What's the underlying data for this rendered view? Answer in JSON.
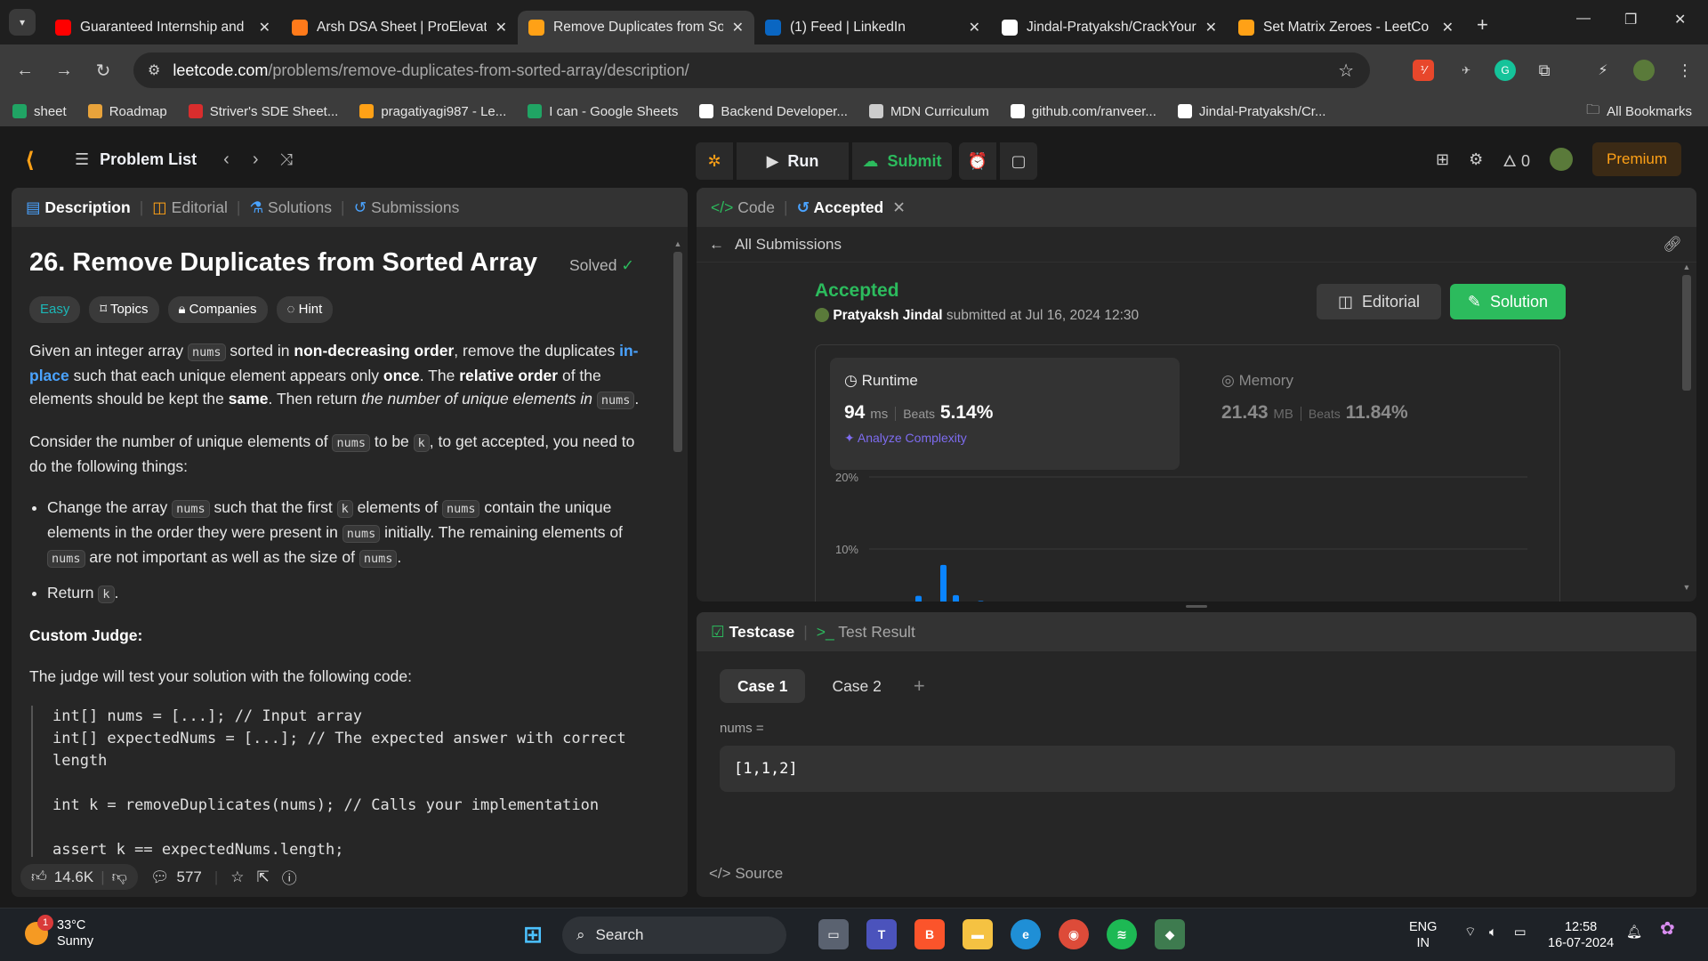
{
  "browser": {
    "tabs": [
      {
        "title": "Guaranteed Internship and",
        "favicon": "youtube-icon",
        "color": "#ff0000"
      },
      {
        "title": "Arsh DSA Sheet | ProElevat",
        "favicon": "proelevate-icon",
        "color": "#ff7a1a"
      },
      {
        "title": "Remove Duplicates from So",
        "favicon": "leetcode-icon",
        "color": "#ffa116",
        "active": true
      },
      {
        "title": "(1) Feed | LinkedIn",
        "favicon": "linkedin-icon",
        "color": "#0a66c2"
      },
      {
        "title": "Jindal-Pratyaksh/CrackYour",
        "favicon": "github-icon",
        "color": "#ffffff"
      },
      {
        "title": "Set Matrix Zeroes - LeetCo",
        "favicon": "leetcode-icon",
        "color": "#ffa116"
      }
    ],
    "url_host": "leetcode.com",
    "url_path": "/problems/remove-duplicates-from-sorted-array/description/",
    "bookmarks": [
      {
        "label": "sheet",
        "color": "#20a464"
      },
      {
        "label": "Roadmap",
        "color": "#e8a33b"
      },
      {
        "label": "Striver's SDE Sheet...",
        "color": "#d92d2d"
      },
      {
        "label": "pragatiyagi987 - Le...",
        "color": "#ffa116"
      },
      {
        "label": "I can - Google Sheets",
        "color": "#20a464"
      },
      {
        "label": "Backend Developer...",
        "color": "#ffffff"
      },
      {
        "label": "MDN Curriculum",
        "color": "#cccccc"
      },
      {
        "label": "github.com/ranveer...",
        "color": "#ffffff"
      },
      {
        "label": "Jindal-Pratyaksh/Cr...",
        "color": "#ffffff"
      }
    ],
    "all_bookmarks": "All Bookmarks"
  },
  "lc": {
    "problem_list": "Problem List",
    "run": "Run",
    "submit": "Submit",
    "streak": "0",
    "premium": "Premium",
    "desc_tabs": [
      "Description",
      "Editorial",
      "Solutions",
      "Submissions"
    ],
    "title": "26. Remove Duplicates from Sorted Array",
    "solved": "Solved",
    "chips": [
      "Easy",
      "Topics",
      "Companies",
      "Hint"
    ],
    "likes": "14.6K",
    "comments": "577",
    "code_tabs": [
      "Code",
      "Accepted"
    ],
    "all_submissions": "All Submissions",
    "status": "Accepted",
    "user": "Pratyaksh Jindal",
    "submitted_at": "submitted at Jul 16, 2024 12:30",
    "editorial_btn": "Editorial",
    "solution_btn": "Solution",
    "runtime_label": "Runtime",
    "runtime_value": "94",
    "runtime_unit": "ms",
    "beats_label": "Beats",
    "runtime_beats": "5.14%",
    "analyze": "Analyze Complexity",
    "memory_label": "Memory",
    "memory_value": "21.43",
    "memory_unit": "MB",
    "memory_beats": "11.84%",
    "test_tabs": [
      "Testcase",
      "Test Result"
    ],
    "cases": [
      "Case 1",
      "Case 2"
    ],
    "nums_label": "nums =",
    "nums_value": "[1,1,2]",
    "source": "Source"
  },
  "chart_data": {
    "type": "bar",
    "ylim": [
      0,
      20
    ],
    "ytick_labels": [
      "20%",
      "10%"
    ],
    "values": [
      3.5,
      0,
      7.8,
      3.6,
      0,
      2.8,
      0.4
    ]
  },
  "taskbar": {
    "temp": "33°C",
    "condition": "Sunny",
    "notif": "1",
    "search": "Search",
    "lang1": "ENG",
    "lang2": "IN",
    "time": "12:58",
    "date": "16-07-2024"
  }
}
